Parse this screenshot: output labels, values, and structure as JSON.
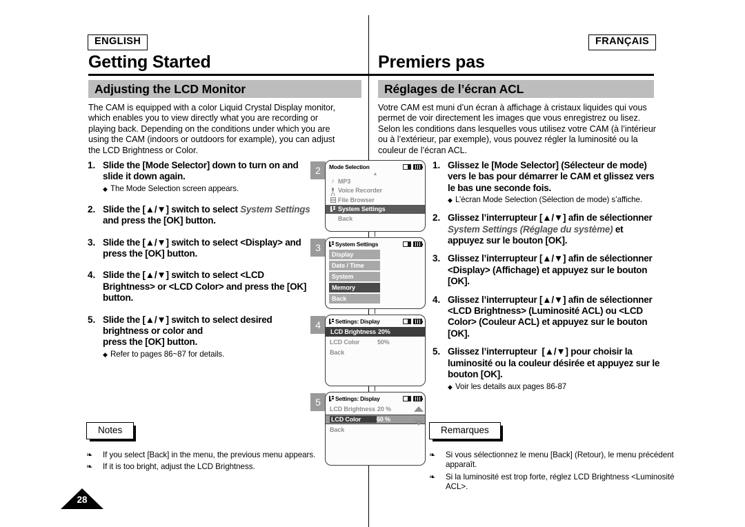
{
  "page": {
    "number": "28"
  },
  "english": {
    "lang_tag": "ENGLISH",
    "chapter": "Getting Started",
    "section": "Adjusting the LCD Monitor",
    "intro": "The CAM is equipped with a color Liquid Crystal Display monitor, which enables you to view directly what you are recording or playing back. Depending on the conditions under which you are using the CAM (indoors or outdoors for example), you can adjust the LCD Brightness or Color.",
    "steps": [
      {
        "num": "1.",
        "text_html": "Slide the [Mode Selector] down to turn on and slide it down again.",
        "sub": "The Mode Selection screen appears."
      },
      {
        "num": "2.",
        "text_html": "Slide the [▲/▼] switch to select <i class=\"em\">System Settings</i> and press the [OK] button.",
        "sub": ""
      },
      {
        "num": "3.",
        "text_html": "Slide the [▲/▼] switch to select &lt;Display&gt; and press the [OK] button.",
        "sub": ""
      },
      {
        "num": "4.",
        "text_html": "Slide the [▲/▼] switch to select &lt;LCD Brightness&gt; or &lt;LCD Color&gt; and press the [OK] button.",
        "sub": ""
      },
      {
        "num": "5.",
        "text_html": "Slide the [▲/▼] switch to select desired brightness or color and<br>press the [OK] button.",
        "sub": "Refer to pages 86~87 for details."
      }
    ],
    "notes_label": "Notes",
    "notes": [
      "If you select [Back] in the menu, the previous menu appears.",
      "If it is too bright, adjust the LCD Brightness."
    ]
  },
  "french": {
    "lang_tag": "FRANÇAIS",
    "chapter": "Premiers pas",
    "section": "Réglages de l’écran ACL",
    "intro": "Votre CAM est muni d’un écran à affichage à cristaux liquides qui vous permet de voir directement les images que vous enregistrez ou lisez. Selon les conditions dans lesquelles vous utilisez votre CAM (à l’intérieur ou à l’extérieur, par exemple), vous pouvez régler la luminosité ou la couleur de l’écran ACL.",
    "steps": [
      {
        "num": "1.",
        "text_html": "Glissez le [Mode Selector] (Sélecteur de mode) vers le bas pour démarrer le CAM et glissez vers le bas une seconde fois.",
        "sub": "L’écran Mode Selection (Sélection de mode) s’affiche."
      },
      {
        "num": "2.",
        "text_html": "Glissez l’interrupteur [▲/▼] afin de sélectionner <i class=\"em\">System Settings (Réglage du système)</i> et appuyez sur le bouton [OK].",
        "sub": ""
      },
      {
        "num": "3.",
        "text_html": "Glissez l’interrupteur [▲/▼] afin de sélectionner &lt;Display&gt; (Affichage) et appuyez sur le bouton [OK].",
        "sub": ""
      },
      {
        "num": "4.",
        "text_html": "Glissez l’interrupteur [▲/▼] afin de sélectionner &lt;LCD Brightness&gt; (Luminosité ACL) ou &lt;LCD Color&gt; (Couleur ACL) et appuyez sur le bouton [OK].",
        "sub": ""
      },
      {
        "num": "5.",
        "text_html": "Glissez l’interrupteur&nbsp; [▲/▼] pour choisir la luminosité ou la couleur désirée et appuyez sur le bouton [OK].",
        "sub": "Voir les details aux pages 86-87"
      }
    ],
    "notes_label": "Remarques",
    "notes": [
      "Si vous sélectionnez le menu [Back] (Retour), le menu précédent apparaît.",
      "Si la luminosité est trop forte, réglez LCD Brightness <Luminosité ACL>."
    ]
  },
  "screens": [
    {
      "badge": "2",
      "title": "Mode Selection",
      "title_icon": "none",
      "items": [
        {
          "label": "MP3",
          "icon": "music-note-icon",
          "state": "normal"
        },
        {
          "label": "Voice Recorder",
          "icon": "microphone-icon",
          "state": "normal"
        },
        {
          "label": "File Browser",
          "icon": "file-icon",
          "state": "normal"
        },
        {
          "label": "System Settings",
          "icon": "settings-icon",
          "state": "selected"
        },
        {
          "label": "Back",
          "icon": "none",
          "state": "normal"
        }
      ]
    },
    {
      "badge": "3",
      "title": "System Settings",
      "title_icon": "settings-icon",
      "items": [
        {
          "label": "Display",
          "state": "normal"
        },
        {
          "label": "Date / Time",
          "state": "normal"
        },
        {
          "label": "System",
          "state": "normal"
        },
        {
          "label": "Memory",
          "state": "selected"
        },
        {
          "label": "Back",
          "state": "normal"
        }
      ]
    },
    {
      "badge": "4",
      "title": "Settings: Display",
      "title_icon": "settings-icon",
      "rows": [
        {
          "label": "LCD Brightness",
          "value": "20%",
          "state": "highlight-row"
        },
        {
          "label": "LCD Color",
          "value": "50%",
          "state": "normal"
        }
      ],
      "back": "Back"
    },
    {
      "badge": "5",
      "title": "Settings: Display",
      "title_icon": "settings-icon",
      "rows": [
        {
          "label": "LCD Brightness",
          "value": "20 %",
          "state": "normal"
        },
        {
          "label": "LCD Color",
          "value": "60 %",
          "state": "band"
        }
      ],
      "back": "Back",
      "scroll": {
        "up": "scroll-up-arrow",
        "down": "scroll-down-arrow"
      }
    }
  ]
}
